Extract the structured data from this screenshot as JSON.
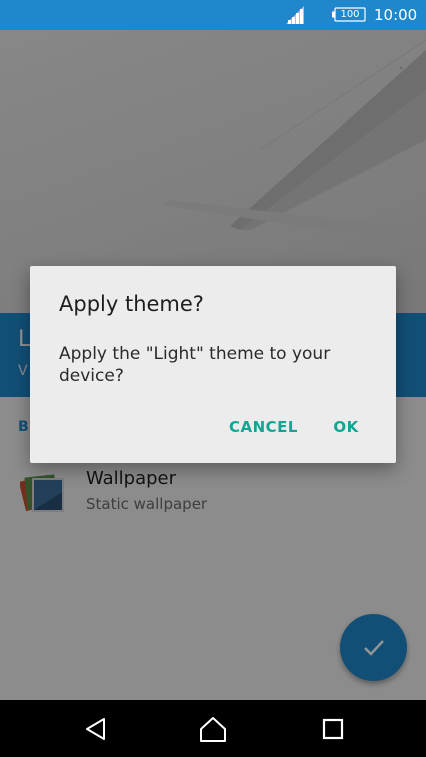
{
  "status_bar": {
    "battery_level": "100",
    "time": "10:00",
    "color": "#1f88cc"
  },
  "theme": {
    "name_partial": "L",
    "subtitle_partial": "V"
  },
  "section_header_partial": "B",
  "wallpaper_item": {
    "title": "Wallpaper",
    "subtitle": "Static wallpaper"
  },
  "dialog": {
    "title": "Apply theme?",
    "message": "Apply the \"Light\" theme to your device?",
    "cancel_label": "CANCEL",
    "ok_label": "OK",
    "button_color": "#11a693"
  },
  "icons": {
    "signal": "signal-icon",
    "battery": "battery-icon",
    "fab": "checkmark-icon",
    "nav": [
      "back-icon",
      "home-icon",
      "recents-icon"
    ]
  }
}
